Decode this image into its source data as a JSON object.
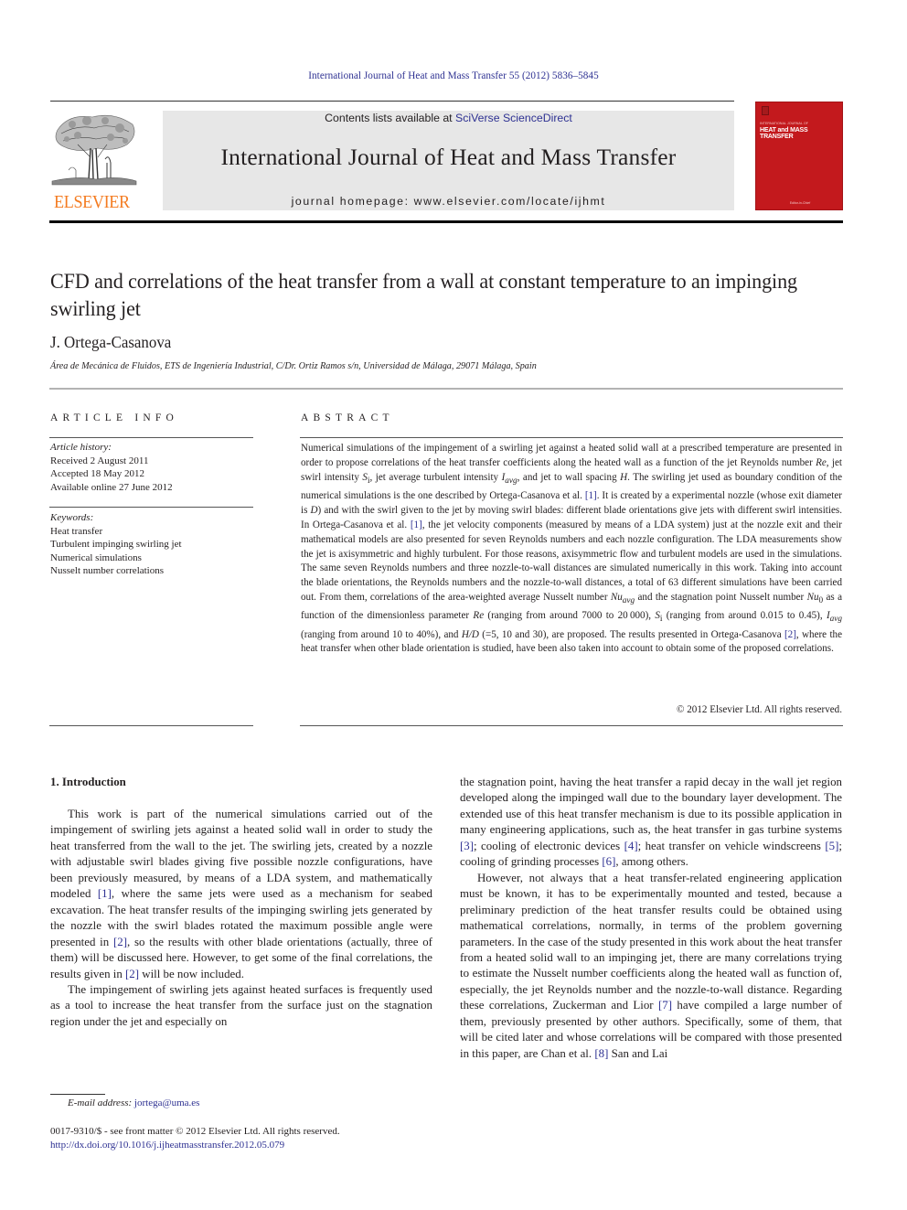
{
  "header": {
    "citation": "International Journal of Heat and Mass Transfer 55 (2012) 5836–5845",
    "publisher_logo_text": "ELSEVIER",
    "contents_prefix": "Contents lists available at ",
    "contents_link": "SciVerse ScienceDirect",
    "journal_title": "International Journal of Heat and Mass Transfer",
    "homepage_prefix": "journal homepage: ",
    "homepage_url": "www.elsevier.com/locate/ijhmt",
    "cover": {
      "kicker": "INTERNATIONAL JOURNAL OF",
      "title": "HEAT and MASS\nTRANSFER",
      "footer": "Editor-in-Chief",
      "color": "#c3191d"
    },
    "brand_orange": "#f47b20",
    "link_color": "#2e3192"
  },
  "article": {
    "title": "CFD and correlations of the heat transfer from a wall at constant temperature to an impinging swirling jet",
    "author": "J. Ortega-Casanova",
    "affiliation": "Área de Mecánica de Fluidos, ETS de Ingeniería Industrial, C/Dr. Ortiz Ramos s/n, Universidad de Málaga, 29071 Málaga, Spain"
  },
  "article_info": {
    "label": "ARTICLE INFO",
    "history_label": "Article history:",
    "history": [
      "Received 2 August 2011",
      "Accepted 18 May 2012",
      "Available online 27 June 2012"
    ],
    "keywords_label": "Keywords:",
    "keywords": [
      "Heat transfer",
      "Turbulent impinging swirling jet",
      "Numerical simulations",
      "Nusselt number correlations"
    ]
  },
  "abstract": {
    "label": "ABSTRACT",
    "p1": "Numerical simulations of the impingement of a swirling jet against a heated solid wall at a prescribed temperature are presented in order to propose correlations of the heat transfer coefficients along the heated wall as a function of the jet Reynolds number ",
    "re": "Re",
    "p2": ", jet swirl intensity ",
    "si": "S",
    "si_sub": "i",
    "p3": ", jet average turbulent inten­sity ",
    "iavg": "I",
    "iavg_sub": "avg",
    "p4": ", and jet to wall spacing ",
    "h": "H",
    "p5": ". The swirling jet used as boundary condition of the numerical simula­tions is the one described by Ortega-Casanova et al. ",
    "ref1": "[1]",
    "p6": ". It is created by a experimental nozzle (whose exit diameter is ",
    "d": "D",
    "p7": ") and with the swirl given to the jet by moving swirl blades: different blade orientations give jets with different swirl intensities. In Ortega-Casanova et al. ",
    "ref1b": "[1]",
    "p8": ", the jet velocity components (measured by means of a LDA system) just at the nozzle exit and their mathematical models are also presented for seven Reynolds numbers and each nozzle configuration. The LDA measurements show the jet is axisym­metric and highly turbulent. For those reasons, axisymmetric flow and turbulent models are used in the simulations. The same seven Reynolds numbers and three nozzle-to-wall distances are simulated numer­ically in this work. Taking into account the blade orientations, the Reynolds numbers and the nozzle-to-wall distances, a total of 63 different simulations have been carried out. From them, correlations of the area-weighted average Nusselt number ",
    "nu": "Nu",
    "nu_avg_sub": "avg",
    "p9": " and the stagnation point Nusselt number ",
    "nu0_sub": "0",
    "p10": " as a function of the dimensionless parameter ",
    "re2": "Re",
    "p11": " (ranging from around 7000 to 20 000), ",
    "p12": " (ranging from around 0.015 to 0.45), ",
    "p13": " (ranging from around 10 to 40%), and ",
    "hd": "H/D",
    "p14": " (=5, 10 and 30), are proposed. The results pre­sented in Ortega-Casanova ",
    "ref2": "[2]",
    "p15": ", where the heat transfer when other blade orientation is studied, have been also taken into account to obtain some of the proposed correlations.",
    "copyright": "© 2012 Elsevier Ltd. All rights reserved."
  },
  "introduction": {
    "heading": "1. Introduction",
    "left": {
      "a1": "This work is part of the numerical simulations carried out of the impingement of swirling jets against a heated solid wall in order to study the heat transferred from the wall to the jet. The swirling jets, created by a nozzle with adjustable swirl blades giving five possible nozzle configurations, have been previously measured, by means of a LDA system, and mathematically modeled ",
      "r1": "[1]",
      "a2": ", where the same jets were used as a mechanism for seabed excavation. The heat transfer results of the impinging swirling jets generated by the nozzle with the swirl blades rotated the maximum possible angle were presented in ",
      "r2": "[2]",
      "a3": ", so the results with other blade orien­tations (actually, three of them) will be discussed here. However, to get some of the final correlations, the results given in ",
      "r2b": "[2]",
      "a4": " will be now included.",
      "b1": "The impingement of swirling jets against heated surfaces is frequently used as a tool to increase the heat transfer from the sur­face just on the stagnation region under the jet and especially on"
    },
    "right": {
      "c1": "the stagnation point, having the heat transfer a rapid decay in the wall jet region developed along the impinged wall due to the boundary layer development. The extended use of this heat trans­fer mechanism is due to its possible application in many engineer­ing applications, such as, the heat transfer in gas turbine systems ",
      "r3": "[3]",
      "c2": "; cooling of electronic devices ",
      "r4": "[4]",
      "c3": "; heat transfer on vehicle windscreens ",
      "r5": "[5]",
      "c4": "; cooling of grinding processes ",
      "r6": "[6]",
      "c5": ", among others.",
      "d1": "However, not always that a heat transfer-related engineering application must be known, it has to be experimentally mounted and tested, because a preliminary prediction of the heat transfer results could be obtained using mathematical correlations, nor­mally, in terms of the problem governing parameters. In the case of the study presented in this work about the heat transfer from a heated solid wall to an impinging jet, there are many correlations trying to estimate the Nusselt number coefficients along the heated wall as function of, especially, the jet Reynolds number and the nozzle-to-wall distance. Regarding these correlations, Zuckerman and Lior ",
      "r7": "[7]",
      "d2": " have compiled a large number of them, previously presented by other authors. Specifically, some of them, that will be cited later and whose correlations will be compared with those presented in this paper, are Chan et al. ",
      "r8": "[8]",
      "d3": " San and Lai"
    }
  },
  "footnotes": {
    "email_label": "E-mail address:",
    "email": "jortega@uma.es",
    "front_matter": "0017-9310/$ - see front matter © 2012 Elsevier Ltd. All rights reserved.",
    "doi": "http://dx.doi.org/10.1016/j.ijheatmasstransfer.2012.05.079"
  }
}
